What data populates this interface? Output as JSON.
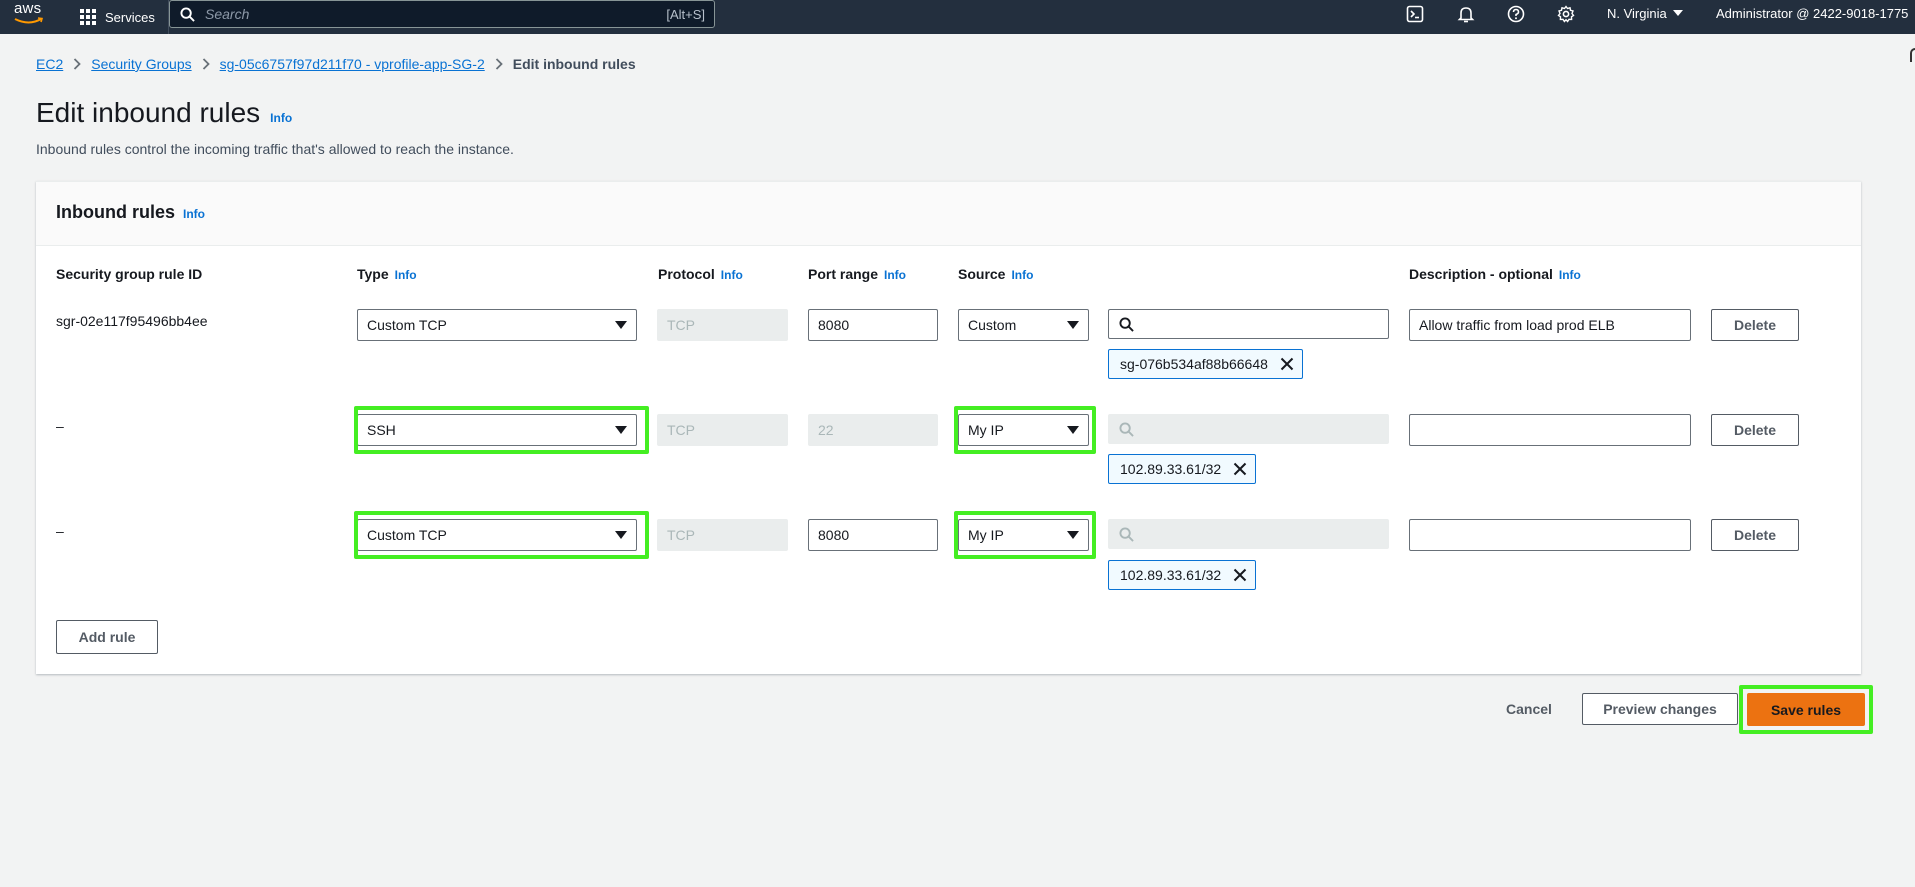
{
  "nav": {
    "logo_text": "aws",
    "services_label": "Services",
    "search_placeholder": "Search",
    "search_hint": "[Alt+S]",
    "region": "N. Virginia",
    "account": "Administrator @ 2422-9018-1775"
  },
  "breadcrumb": {
    "items": [
      "EC2",
      "Security Groups",
      "sg-05c6757f97d211f70 - vprofile-app-SG-2"
    ],
    "current": "Edit inbound rules"
  },
  "page": {
    "title": "Edit inbound rules",
    "title_info": "Info",
    "description": "Inbound rules control the incoming traffic that's allowed to reach the instance."
  },
  "panel": {
    "title": "Inbound rules",
    "info": "Info",
    "columns": {
      "rule_id": "Security group rule ID",
      "type": "Type",
      "protocol": "Protocol",
      "port_range": "Port range",
      "source": "Source",
      "description": "Description - optional",
      "info": "Info"
    },
    "rows": [
      {
        "rule_id": "sgr-02e117f95496bb4ee",
        "type": "Custom TCP",
        "protocol": "TCP",
        "port": "8080",
        "source": "Custom",
        "token": "sg-076b534af88b66648",
        "description": "Allow traffic from load prod ELB",
        "delete": "Delete"
      },
      {
        "rule_id": "–",
        "type": "SSH",
        "protocol": "TCP",
        "port": "22",
        "source": "My IP",
        "token": "102.89.33.61/32",
        "description": "",
        "delete": "Delete"
      },
      {
        "rule_id": "–",
        "type": "Custom TCP",
        "protocol": "TCP",
        "port": "8080",
        "source": "My IP",
        "token": "102.89.33.61/32",
        "description": "",
        "delete": "Delete"
      }
    ],
    "add_rule": "Add rule"
  },
  "footer": {
    "cancel": "Cancel",
    "preview": "Preview changes",
    "save": "Save rules"
  },
  "colors": {
    "nav_bg": "#232f3e",
    "link": "#0972d3",
    "primary": "#ec7211",
    "highlight": "#44ee22"
  }
}
